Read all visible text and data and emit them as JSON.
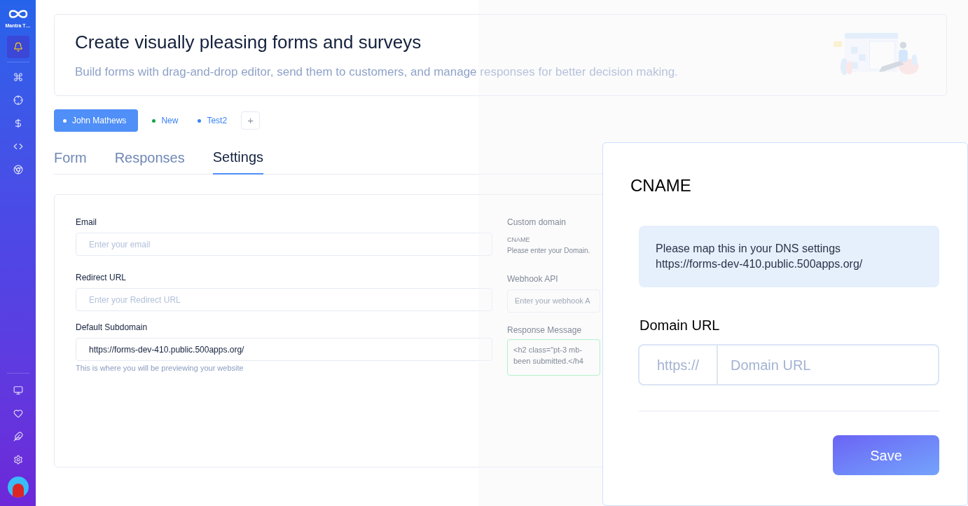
{
  "sidebar": {
    "brand": "Mantra T…",
    "top_items": [
      {
        "selected": true
      },
      {
        "selected": false
      },
      {
        "selected": false
      },
      {
        "selected": false
      },
      {
        "selected": false
      },
      {
        "selected": false
      }
    ],
    "bottom_items": [
      {
        "selected": false
      },
      {
        "selected": false
      },
      {
        "selected": false
      },
      {
        "selected": false
      }
    ]
  },
  "banner": {
    "title": "Create visually pleasing forms and surveys",
    "subtitle": "Build forms with drag-and-drop editor, send them to customers, and manage responses for better decision making.",
    "kind": "picture"
  },
  "forms": [
    {
      "label": "John Mathews",
      "selected": true,
      "color": "#ffffff"
    },
    {
      "label": "New",
      "selected": false,
      "color": "#16a34a"
    },
    {
      "label": "Test2",
      "selected": false,
      "color": "#3b82f6"
    }
  ],
  "add_button": "+",
  "tabs": [
    {
      "label": "Form",
      "selected": false
    },
    {
      "label": "Responses",
      "selected": false
    },
    {
      "label": "Settings",
      "selected": true
    }
  ],
  "settings": {
    "left": [
      {
        "label": "Email",
        "placeholder": "Enter your email"
      },
      {
        "label": "Redirect URL",
        "placeholder": "Enter your Redirect URL"
      },
      {
        "label": "Default Subdomain",
        "value": "https://forms-dev-410.public.500apps.org/",
        "hint": "This is where you will be previewing your website"
      }
    ],
    "right": {
      "custom_domain": "Custom domain",
      "cname_label": "CNAME",
      "cname_text": "Please enter your Domain.",
      "webhook_label": "Webhook API",
      "webhook_placeholder": "Enter your webhook A",
      "response_label": "Response Message",
      "response_lines": [
        "<h2 class=\"pt-3 mb-",
        "been submitted.</h4"
      ]
    }
  },
  "dialog": {
    "title": "CNAME",
    "info_lines": [
      "Please map this in your DNS settings",
      "https://forms-dev-410.public.500apps.org/"
    ],
    "domain_label": "Domain URL",
    "prefix": "https://",
    "domain_placeholder": "Domain URL",
    "save": "Save"
  }
}
